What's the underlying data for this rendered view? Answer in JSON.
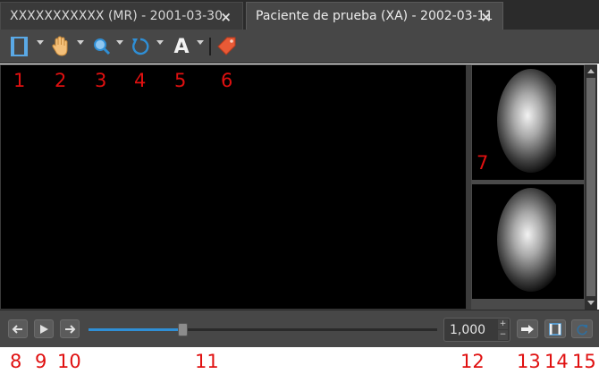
{
  "tabs": [
    {
      "label": "XXXXXXXXXXX (MR) - 2001-03-30",
      "close": "×"
    },
    {
      "label": "Paciente de prueba (XA) - 2002-03-11",
      "close": "×"
    }
  ],
  "toolbar": {
    "tools": [
      "layout-icon",
      "pan-hand-icon",
      "zoom-icon",
      "rotate-icon",
      "annotation-text-icon",
      "tag-icon"
    ],
    "text_tool_glyph": "A"
  },
  "playback": {
    "frame_value": "1,000",
    "spin_up": "+",
    "spin_down": "−",
    "progress": 0.27
  },
  "callouts": {
    "n1": "1",
    "n2": "2",
    "n3": "3",
    "n4": "4",
    "n5": "5",
    "n6": "6",
    "n7": "7",
    "n8": "8",
    "n9": "9",
    "n10": "10",
    "n11": "11",
    "n12": "12",
    "n13": "13",
    "n14": "14",
    "n15": "15"
  },
  "colors": {
    "accent": "#2f8fd6",
    "callout": "#e01010",
    "background": "#474747"
  }
}
